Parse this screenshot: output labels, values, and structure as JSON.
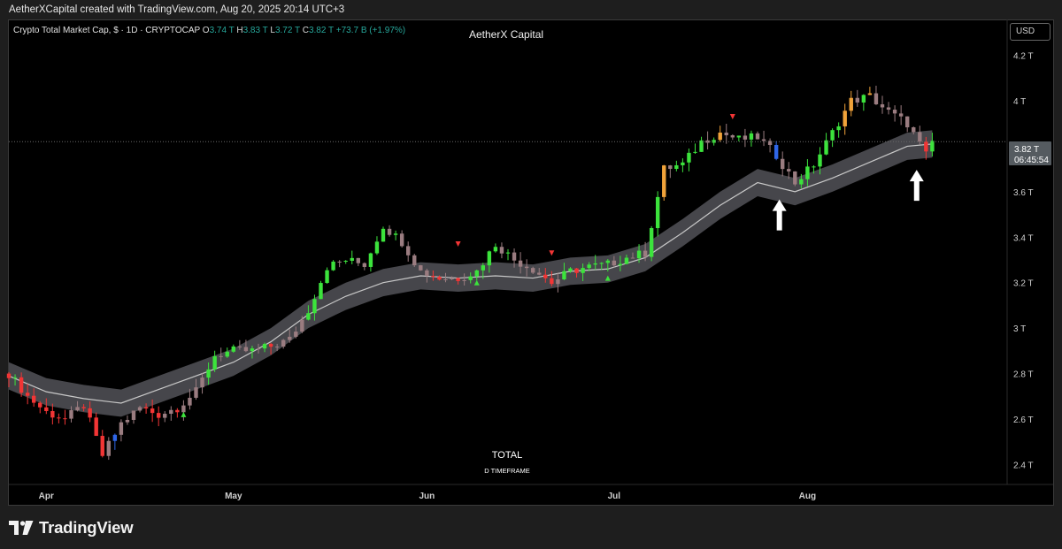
{
  "header": {
    "attribution": "AetherXCapital created with TradingView.com, Aug 20, 2025 20:14 UTC+3"
  },
  "legend": {
    "symbol": "Crypto Total Market Cap, $ · 1D · CRYPTOCAP",
    "open_label": "O",
    "open": "3.74 T",
    "high_label": "H",
    "high": "3.83 T",
    "low_label": "L",
    "low": "3.72 T",
    "close_label": "C",
    "close": "3.82 T",
    "change": "+73.7 B (+1.97%)"
  },
  "watermark_top": "AetherX Capital",
  "currency_button": "USD",
  "price_tag": {
    "price": "3.82 T",
    "countdown": "06:45:54"
  },
  "bottom_labels": {
    "symbol": "TOTAL",
    "timeframe": "D TIMEFRAME"
  },
  "footer": {
    "logo_text": "TradingView"
  },
  "colors": {
    "bull": "#3ce33c",
    "bear": "#f23535",
    "bull_hot": "#f1a33a",
    "neutral": "#9a7c80",
    "blue": "#2f66e8",
    "band": "#4a4a4f",
    "basis": "#c8c8c8"
  },
  "chart_data": {
    "type": "line",
    "title": "Crypto Total Market Cap",
    "y_unit": "T",
    "ylim": [
      2.32,
      4.35
    ],
    "y_ticks": [
      "4.2 T",
      "4 T",
      "3.8 T",
      "3.6 T",
      "3.4 T",
      "3.2 T",
      "3 T",
      "2.8 T",
      "2.6 T",
      "2.4 T"
    ],
    "y_tick_values": [
      4.2,
      4.0,
      3.8,
      3.6,
      3.4,
      3.2,
      3.0,
      2.8,
      2.6,
      2.4
    ],
    "x_ticks": [
      "Apr",
      "May",
      "Jun",
      "Jul",
      "Aug"
    ],
    "x_tick_days": [
      6,
      36,
      67,
      97,
      128
    ],
    "x_range_days": [
      0,
      140
    ],
    "last_price": 3.82,
    "series": [
      {
        "kind": "close_approx",
        "days": [
          0,
          3,
          6,
          9,
          12,
          15,
          18,
          21,
          24,
          27,
          30,
          33,
          36,
          39,
          42,
          45,
          48,
          51,
          54,
          57,
          60,
          63,
          66,
          69,
          72,
          75,
          78,
          81,
          84,
          87,
          90,
          93,
          96,
          99,
          102,
          105,
          108,
          111,
          114,
          117,
          120,
          123,
          126,
          129,
          132,
          135,
          138,
          141,
          144,
          147,
          148
        ],
        "values": [
          2.8,
          2.7,
          2.63,
          2.6,
          2.66,
          2.44,
          2.58,
          2.65,
          2.62,
          2.65,
          2.72,
          2.88,
          2.9,
          2.9,
          2.92,
          2.95,
          3.08,
          3.27,
          3.3,
          3.28,
          3.45,
          3.38,
          3.25,
          3.22,
          3.22,
          3.25,
          3.37,
          3.3,
          3.26,
          3.2,
          3.25,
          3.27,
          3.28,
          3.31,
          3.33,
          3.7,
          3.72,
          3.82,
          3.86,
          3.83,
          3.84,
          3.76,
          3.64,
          3.72,
          3.86,
          4.0,
          4.02,
          3.95,
          3.9,
          3.76,
          3.82
        ]
      },
      {
        "kind": "basis",
        "days": [
          0,
          6,
          12,
          18,
          24,
          30,
          36,
          42,
          48,
          54,
          60,
          66,
          72,
          78,
          84,
          90,
          96,
          102,
          108,
          114,
          120,
          126,
          132,
          138,
          144,
          148
        ],
        "values": [
          2.79,
          2.72,
          2.69,
          2.67,
          2.73,
          2.79,
          2.85,
          2.94,
          3.06,
          3.14,
          3.2,
          3.23,
          3.22,
          3.23,
          3.22,
          3.25,
          3.26,
          3.31,
          3.42,
          3.54,
          3.64,
          3.6,
          3.66,
          3.73,
          3.8,
          3.81
        ]
      }
    ],
    "annotations": [
      {
        "type": "arrow_up",
        "day": 123.5,
        "value": 3.43
      },
      {
        "type": "arrow_up",
        "day": 145.5,
        "value": 3.56
      }
    ]
  }
}
